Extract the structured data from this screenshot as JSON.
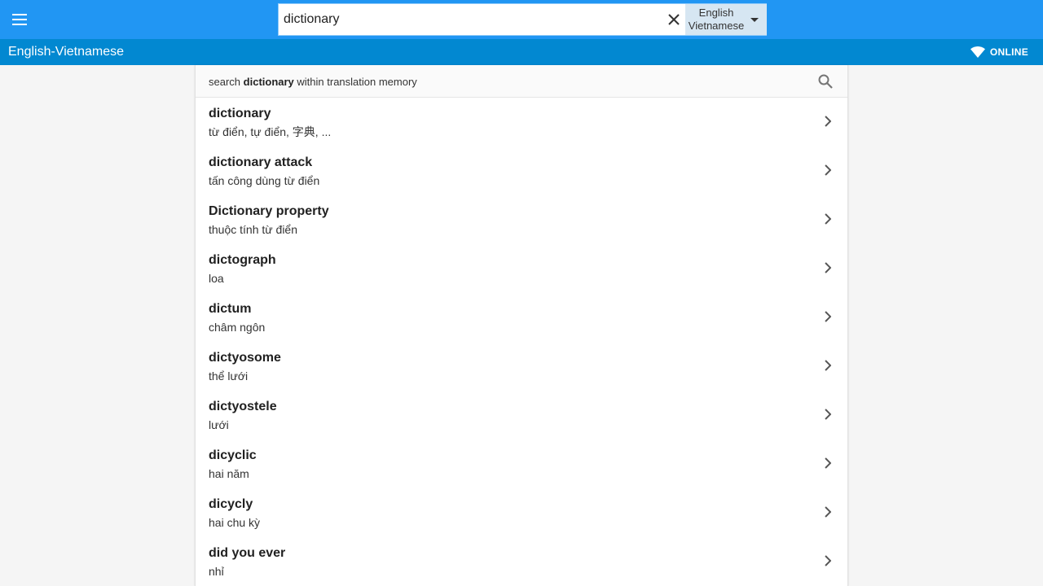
{
  "topbar": {
    "menu_icon": "hamburger-menu-icon",
    "search": {
      "value": "dictionary",
      "placeholder": ""
    },
    "clear_icon": "close-icon",
    "language": {
      "from": "English",
      "to": "Vietnamese",
      "caret_icon": "caret-down-icon"
    },
    "colors": {
      "bar": "#2196f3",
      "subbar": "#0288d1"
    }
  },
  "subbar": {
    "title": "English-Vietnamese",
    "status": "ONLINE",
    "status_icon": "wifi-icon"
  },
  "translation_memory": {
    "prefix": "search",
    "term": "dictionary",
    "suffix": "within translation memory",
    "icon": "search-icon"
  },
  "results": [
    {
      "word": "dictionary",
      "translation": "từ điển, tự điển, 字典, ..."
    },
    {
      "word": "dictionary attack",
      "translation": "tấn công dùng từ điển"
    },
    {
      "word": "Dictionary property",
      "translation": "thuộc tính từ điển"
    },
    {
      "word": "dictograph",
      "translation": "loa"
    },
    {
      "word": "dictum",
      "translation": "châm ngôn"
    },
    {
      "word": "dictyosome",
      "translation": "thể lưới"
    },
    {
      "word": "dictyostele",
      "translation": "lưới"
    },
    {
      "word": "dicyclic",
      "translation": "hai năm"
    },
    {
      "word": "dicycly",
      "translation": "hai chu kỳ"
    },
    {
      "word": "did you ever",
      "translation": "nhỉ"
    }
  ]
}
